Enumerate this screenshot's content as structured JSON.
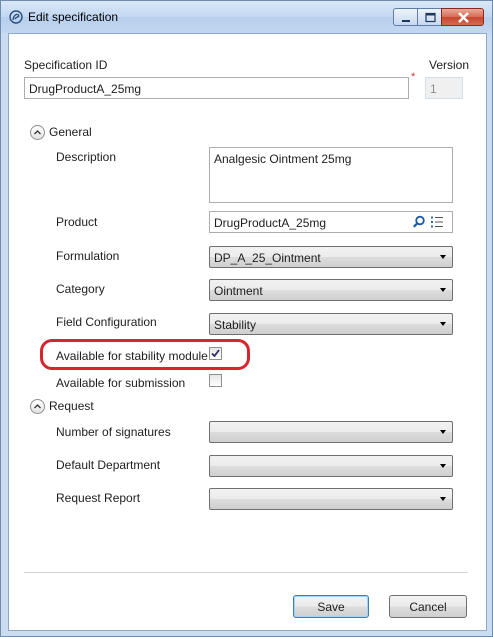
{
  "window": {
    "title": "Edit specification"
  },
  "header": {
    "spec_id_label": "Specification ID",
    "spec_id_value": "DrugProductA_25mg",
    "required_marker": "*",
    "version_label": "Version",
    "version_value": "1"
  },
  "general": {
    "header": "General",
    "description_label": "Description",
    "description_value": "Analgesic Ointment 25mg",
    "product_label": "Product",
    "product_value": "DrugProductA_25mg",
    "formulation_label": "Formulation",
    "formulation_value": "DP_A_25_Ointment",
    "category_label": "Category",
    "category_value": "Ointment",
    "field_config_label": "Field Configuration",
    "field_config_value": "Stability",
    "stability_label": "Available for stability module",
    "stability_checked": true,
    "submission_label": "Available for submission",
    "submission_checked": false
  },
  "request": {
    "header": "Request",
    "signatures_label": "Number of signatures",
    "signatures_value": "",
    "department_label": "Default Department",
    "department_value": "",
    "report_label": "Request Report",
    "report_value": ""
  },
  "footer": {
    "save_label": "Save",
    "cancel_label": "Cancel"
  },
  "colors": {
    "highlight": "#d8242b",
    "accent": "#3c7fb1",
    "close": "#c7472f"
  }
}
